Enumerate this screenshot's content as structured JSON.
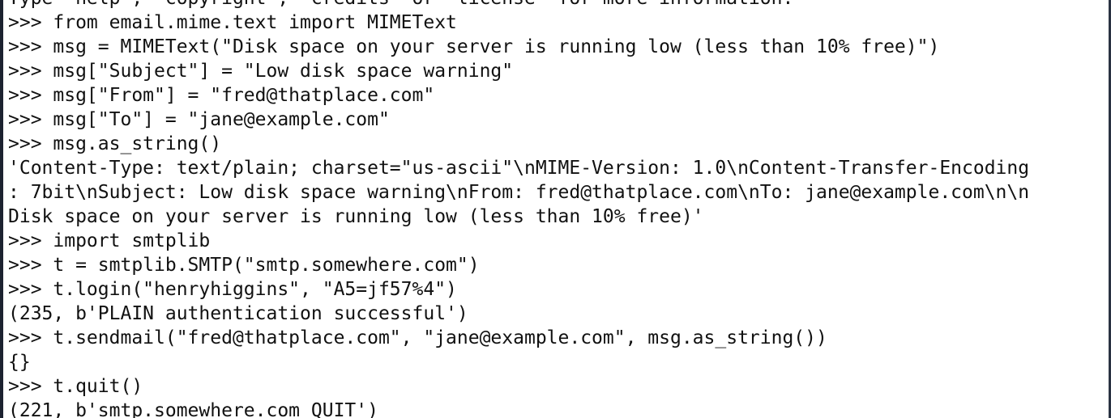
{
  "terminal": {
    "lines": [
      "Type \"help\", \"copyright\", \"credits\" or \"license\" for more information.",
      ">>> from email.mime.text import MIMEText",
      ">>> msg = MIMEText(\"Disk space on your server is running low (less than 10% free)\")",
      ">>> msg[\"Subject\"] = \"Low disk space warning\"",
      ">>> msg[\"From\"] = \"fred@thatplace.com\"",
      ">>> msg[\"To\"] = \"jane@example.com\"",
      ">>> msg.as_string()",
      "'Content-Type: text/plain; charset=\"us-ascii\"\\nMIME-Version: 1.0\\nContent-Transfer-Encoding",
      ": 7bit\\nSubject: Low disk space warning\\nFrom: fred@thatplace.com\\nTo: jane@example.com\\n\\n",
      "Disk space on your server is running low (less than 10% free)'",
      ">>> import smtplib",
      ">>> t = smtplib.SMTP(\"smtp.somewhere.com\")",
      ">>> t.login(\"henryhiggins\", \"A5=jf57%4\")",
      "(235, b'PLAIN authentication successful')",
      ">>> t.sendmail(\"fred@thatplace.com\", \"jane@example.com\", msg.as_string())",
      "{}",
      ">>> t.quit()",
      "(221, b'smtp.somewhere.com QUIT')"
    ]
  }
}
